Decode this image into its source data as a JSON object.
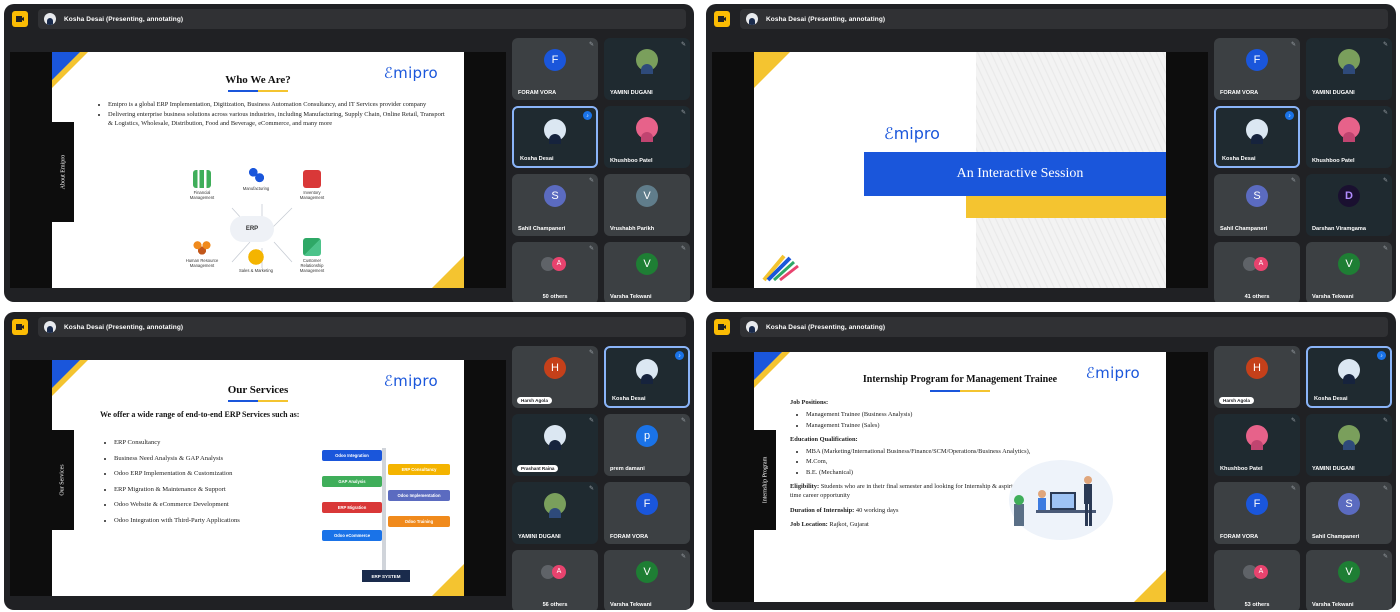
{
  "presenter_bar": "Kosha Desai (Presenting, annotating)",
  "panels": [
    {
      "side_tab": "About Emipro",
      "slide": {
        "logo": "ℰmipro",
        "title": "Who We Are?",
        "bullets": [
          "Emipro is a global ERP Implementation, Digitization, Business Automation Consultancy, and IT Services provider company",
          "Delivering enterprise business solutions across various industries, including Manufacturing, Supply Chain, Online Retail, Transport & Logistics, Wholesale, Distribution, Food and Beverage, eCommerce, and many more"
        ],
        "erp_center": "ERP",
        "erp_items": [
          "Financial Management",
          "Manufacturing",
          "Inventory Management",
          "Human Resource Management",
          "Sales & Marketing",
          "Customer Relationship Management"
        ]
      },
      "tiles": [
        {
          "name": "FORAM VORA",
          "initial": "F",
          "color": "#1a56db"
        },
        {
          "name": "YAMINI DUGANI"
        },
        {
          "name": "Kosha Desai"
        },
        {
          "name": "Khushboo Patel"
        },
        {
          "name": "Sahil Champaneri",
          "initial": "S",
          "color": "#5b6bc0"
        },
        {
          "name": "Vrushabh Parikh",
          "initial": "V",
          "color": "#607d8b"
        },
        {
          "name": "50 others",
          "initial": "A",
          "color": "#e8436e"
        },
        {
          "name": "Varsha Tekwani",
          "initial": "V",
          "color": "#1e7e34"
        }
      ]
    },
    {
      "slide": {
        "logo": "ℰmipro",
        "title": "An Interactive Session"
      },
      "tiles": [
        {
          "name": "FORAM VORA",
          "initial": "F",
          "color": "#1a56db"
        },
        {
          "name": "YAMINI DUGANI"
        },
        {
          "name": "Kosha Desai"
        },
        {
          "name": "Khushboo Patel"
        },
        {
          "name": "Sahil Champaneri",
          "initial": "S",
          "color": "#5b6bc0"
        },
        {
          "name": "Darshan Viramgama",
          "initial": "D"
        },
        {
          "name": "41 others",
          "initial": "A",
          "color": "#e8436e"
        },
        {
          "name": "Varsha Tekwani",
          "initial": "V",
          "color": "#1e7e34"
        }
      ]
    },
    {
      "side_tab": "Our Services",
      "slide": {
        "logo": "ℰmipro",
        "title": "Our Services",
        "subtitle": "We offer a wide range of end-to-end ERP Services such as:",
        "bullets": [
          "ERP Consultancy",
          "Business Need Analysis & GAP Analysis",
          "Odoo ERP Implementation & Customization",
          "ERP Migration & Maintenance & Support",
          "Odoo Website & eCommerce Development",
          "Odoo Integration with Third-Party Applications"
        ],
        "chart_left": [
          "Odoo Integration",
          "GAP Analysis",
          "ERP Migration",
          "Odoo eCommerce"
        ],
        "chart_right": [
          "ERP Consultancy",
          "Odoo Implementation",
          "Odoo Training"
        ],
        "chart_base": "ERP SYSTEM"
      },
      "tiles": [
        {
          "name": "Harsh Agola",
          "initial": "H",
          "color": "#c5401a"
        },
        {
          "name": "Kosha Desai"
        },
        {
          "name": "Prashant Raina"
        },
        {
          "name": "prem damani",
          "initial": "p",
          "color": "#1a73e8"
        },
        {
          "name": "YAMINI DUGANI"
        },
        {
          "name": "FORAM VORA",
          "initial": "F",
          "color": "#1a56db"
        },
        {
          "name": "56 others",
          "initial": "A",
          "color": "#e8436e"
        },
        {
          "name": "Varsha Tekwani",
          "initial": "V",
          "color": "#1e7e34"
        }
      ]
    },
    {
      "side_tab": "Internship Program",
      "slide": {
        "logo": "ℰmipro",
        "title": "Internship Program for Management Trainee",
        "job_positions_label": "Job Positions:",
        "job_positions": [
          "Management Trainee (Business Analysis)",
          "Management Trainee (Sales)"
        ],
        "education_label": "Education Qualification:",
        "education": [
          "MBA (Marketing/International Business/Finance/SCM/Operations/Business Analytics),",
          "M.Com,",
          "B.E. (Mechanical)"
        ],
        "eligibility_label": "Eligibility:",
        "eligibility_text": " Students who are in their final semester and looking for Internship & aspiring for full time career opportunity",
        "duration_label": "Duration of Internship:",
        "duration_text": " 40 working days",
        "location_label": "Job Location:",
        "location_text": " Rajkot, Gujarat"
      },
      "tiles": [
        {
          "name": "Harsh Agola",
          "initial": "H",
          "color": "#c5401a"
        },
        {
          "name": "Kosha Desai"
        },
        {
          "name": "Khushboo Patel"
        },
        {
          "name": "YAMINI DUGANI"
        },
        {
          "name": "FORAM VORA",
          "initial": "F",
          "color": "#1a56db"
        },
        {
          "name": "Sahil Champaneri",
          "initial": "S",
          "color": "#5b6bc0"
        },
        {
          "name": "53 others",
          "initial": "A",
          "color": "#e8436e"
        },
        {
          "name": "Varsha Tekwani",
          "initial": "V",
          "color": "#1e7e34"
        }
      ]
    }
  ]
}
